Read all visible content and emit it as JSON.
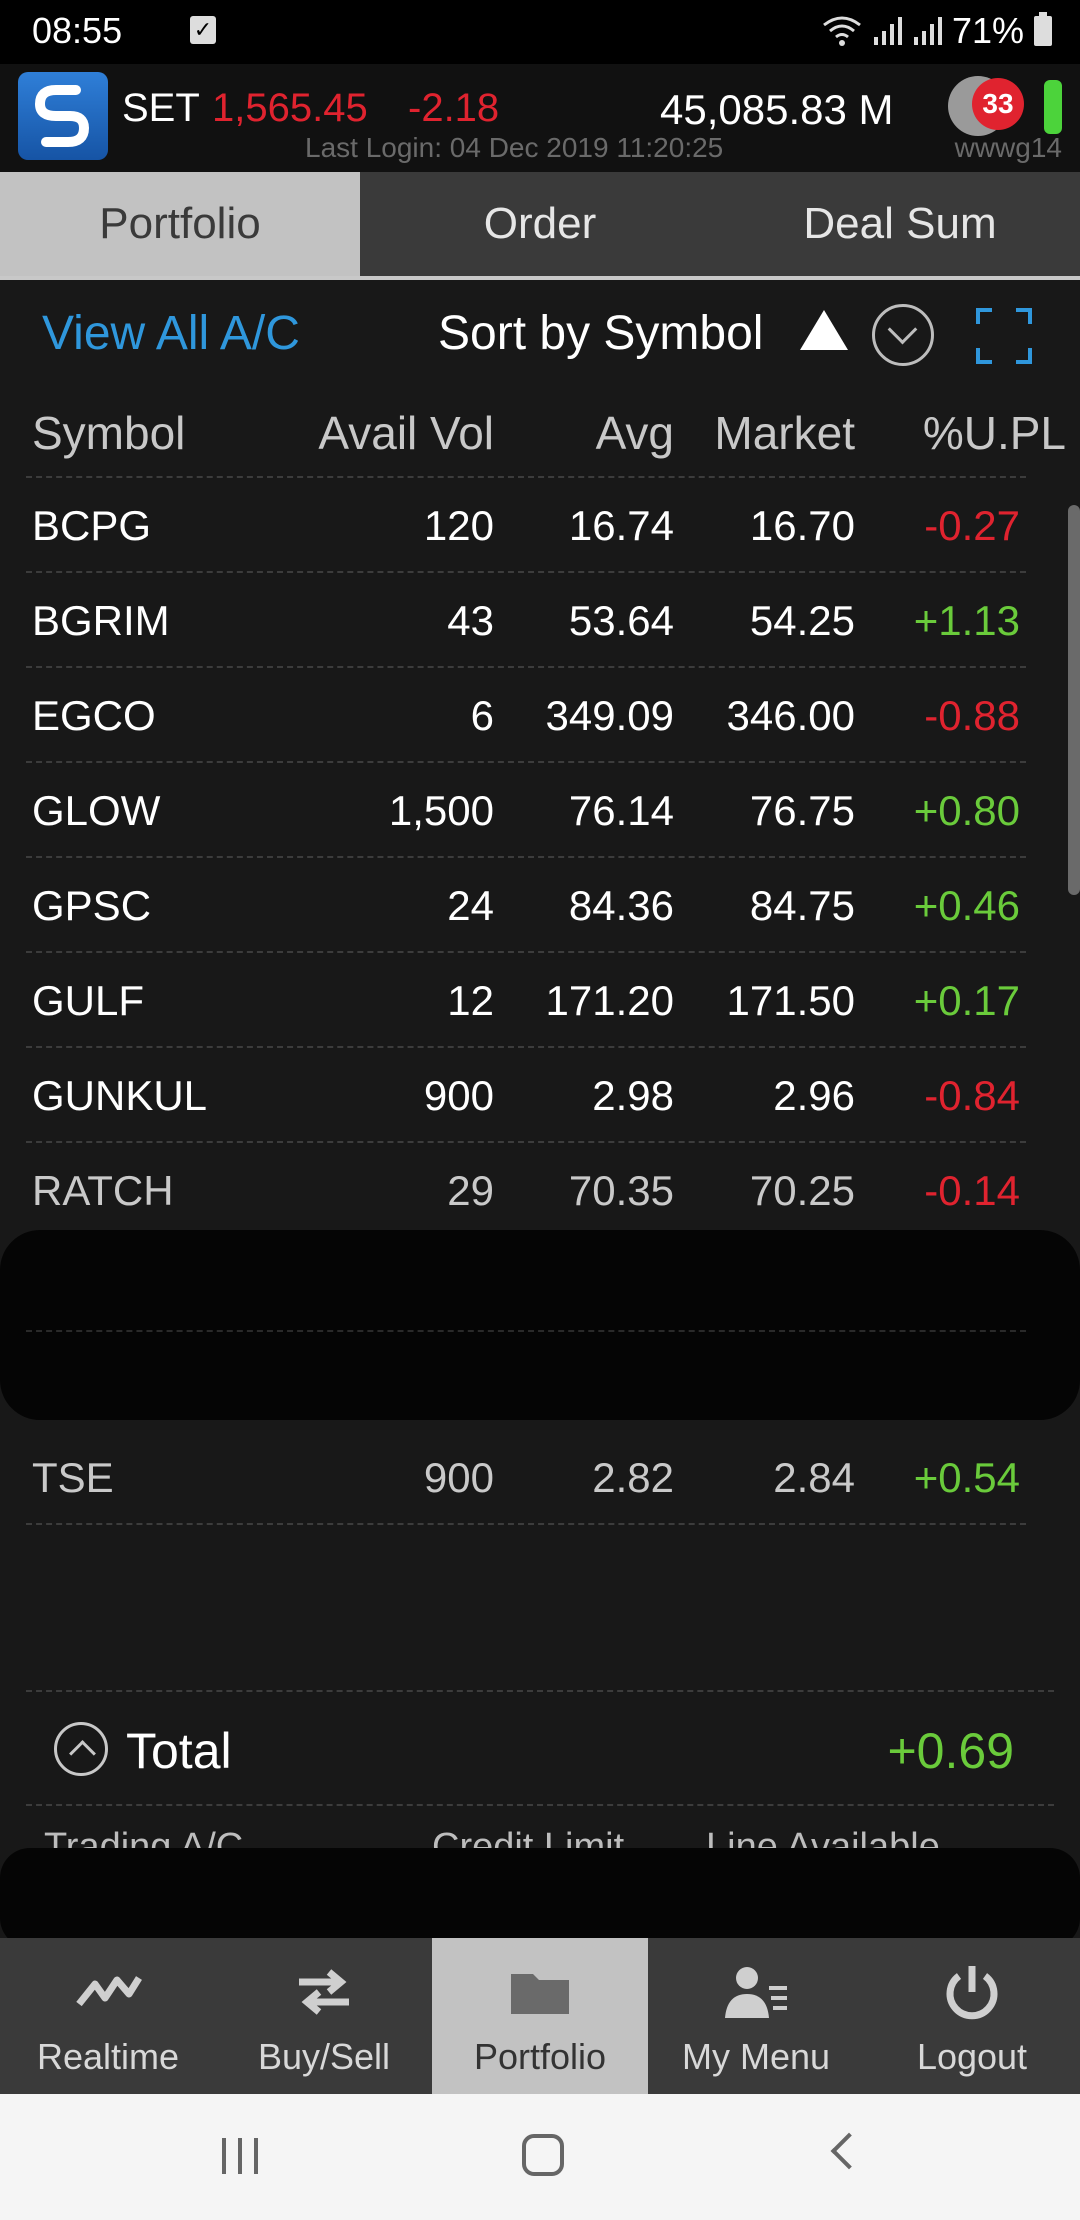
{
  "status_bar": {
    "time": "08:55",
    "battery": "71%"
  },
  "header": {
    "index_name": "SET",
    "index_value": "1,565.45",
    "index_change": "-2.18",
    "market_volume": "45,085.83 M",
    "last_login": "Last Login: 04 Dec 2019 11:20:25",
    "user_id": "wwwg14",
    "notification_count": "33",
    "colors": {
      "negative": "#e0232f",
      "positive": "#6acb3b",
      "link": "#2f97dc",
      "connected": "#4cd33b"
    }
  },
  "tabs": [
    {
      "label": "Portfolio",
      "active": true
    },
    {
      "label": "Order",
      "active": false
    },
    {
      "label": "Deal Sum",
      "active": false
    }
  ],
  "toolbar": {
    "view_all": "View All A/C",
    "sort_label": "Sort by Symbol"
  },
  "table": {
    "headers": {
      "symbol": "Symbol",
      "avail_vol": "Avail Vol",
      "avg": "Avg",
      "market": "Market",
      "upl": "%U.PL"
    },
    "rows": [
      {
        "symbol": "BCPG",
        "avail_vol": "120",
        "avg": "16.74",
        "market": "16.70",
        "upl": "-0.27"
      },
      {
        "symbol": "BGRIM",
        "avail_vol": "43",
        "avg": "53.64",
        "market": "54.25",
        "upl": "+1.13"
      },
      {
        "symbol": "EGCO",
        "avail_vol": "6",
        "avg": "349.09",
        "market": "346.00",
        "upl": "-0.88"
      },
      {
        "symbol": "GLOW",
        "avail_vol": "1,500",
        "avg": "76.14",
        "market": "76.75",
        "upl": "+0.80"
      },
      {
        "symbol": "GPSC",
        "avail_vol": "24",
        "avg": "84.36",
        "market": "84.75",
        "upl": "+0.46"
      },
      {
        "symbol": "GULF",
        "avail_vol": "12",
        "avg": "171.20",
        "market": "171.50",
        "upl": "+0.17"
      },
      {
        "symbol": "GUNKUL",
        "avail_vol": "900",
        "avg": "2.98",
        "market": "2.96",
        "upl": "-0.84"
      },
      {
        "symbol": "RATCH",
        "avail_vol": "29",
        "avg": "70.35",
        "market": "70.25",
        "upl": "-0.14"
      }
    ],
    "last_row": {
      "symbol": "TSE",
      "avail_vol": "900",
      "avg": "2.82",
      "market": "2.84",
      "upl": "+0.54"
    }
  },
  "total": {
    "label": "Total",
    "value": "+0.69",
    "sub_headers": {
      "trading_ac": "Trading A/C",
      "credit_limit": "Credit Limit",
      "line_available": "Line Available"
    }
  },
  "bottom_nav": [
    {
      "label": "Realtime",
      "icon": "trend-icon",
      "active": false
    },
    {
      "label": "Buy/Sell",
      "icon": "swap-icon",
      "active": false
    },
    {
      "label": "Portfolio",
      "icon": "folder-icon",
      "active": true
    },
    {
      "label": "My Menu",
      "icon": "user-menu-icon",
      "active": false
    },
    {
      "label": "Logout",
      "icon": "power-icon",
      "active": false
    }
  ]
}
